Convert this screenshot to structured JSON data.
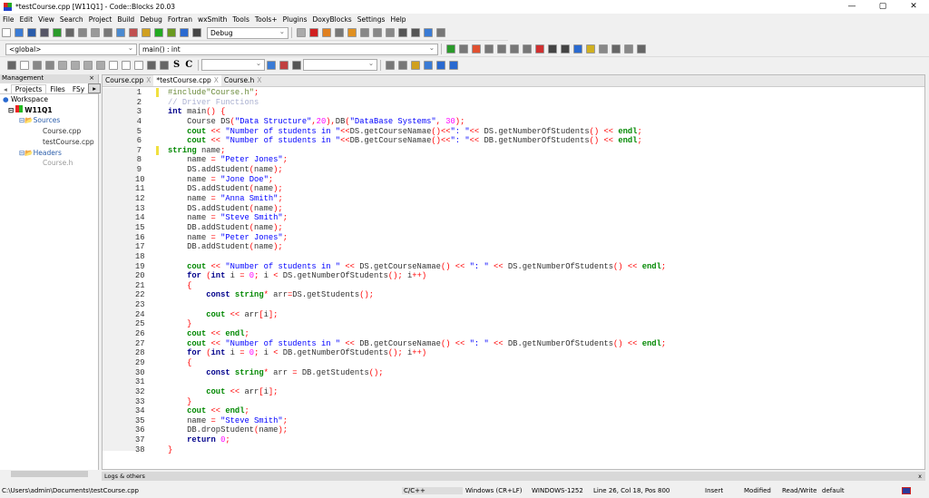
{
  "window": {
    "title": "*testCourse.cpp [W11Q1] - Code::Blocks 20.03",
    "minimize": "—",
    "maximize": "▢",
    "close": "✕"
  },
  "menu": [
    "File",
    "Edit",
    "View",
    "Search",
    "Project",
    "Build",
    "Debug",
    "Fortran",
    "wxSmith",
    "Tools",
    "Tools+",
    "Plugins",
    "DoxyBlocks",
    "Settings",
    "Help"
  ],
  "toolbar": {
    "build_target": "Debug",
    "scope": "<global>",
    "function": "main() : int",
    "search_a": "",
    "search_b": "",
    "bold_s": "S",
    "bold_c": "C"
  },
  "icons1": [
    [
      "new-file-icon",
      "#fff"
    ],
    [
      "open-icon",
      "#3a7bd5"
    ],
    [
      "save-icon",
      "#2a5caa"
    ],
    [
      "save-all-icon",
      "#556"
    ],
    [
      "undo-icon",
      "#2a9a2a"
    ],
    [
      "redo-icon",
      "#666"
    ],
    [
      "cut-icon",
      "#888"
    ],
    [
      "copy-icon",
      "#999"
    ],
    [
      "paste-icon",
      "#777"
    ],
    [
      "find-icon",
      "#4a8ad0"
    ],
    [
      "replace-icon",
      "#c05050"
    ],
    [
      "build-icon",
      "#d0a020"
    ],
    [
      "run-icon",
      "#22aa22"
    ],
    [
      "build-run-icon",
      "#6a9a20"
    ],
    [
      "rebuild-icon",
      "#2a6ad0"
    ],
    [
      "abort-icon",
      "#444"
    ]
  ],
  "icons1b": [
    [
      "debug-info-icon",
      "#aaa"
    ],
    [
      "debug-run-icon",
      "#d02020"
    ],
    [
      "run-to-cursor-icon",
      "#e08020"
    ],
    [
      "next-line-icon",
      "#777"
    ],
    [
      "step-into-icon",
      "#e09020"
    ],
    [
      "step-out-icon",
      "#888"
    ],
    [
      "next-instruction-icon",
      "#888"
    ],
    [
      "step-instruction-icon",
      "#888"
    ],
    [
      "pause-icon",
      "#555"
    ],
    [
      "stop-debug-icon",
      "#555"
    ],
    [
      "debug-windows-icon",
      "#3a7bd5"
    ],
    [
      "info-icon",
      "#777"
    ]
  ],
  "icons2": [
    [
      "back-icon",
      "#2a9a2a"
    ],
    [
      "forward-icon",
      "#777"
    ],
    [
      "bookmark-icon",
      "#e05030"
    ],
    [
      "prev-bookmark-icon",
      "#777"
    ],
    [
      "next-bookmark-icon",
      "#777"
    ],
    [
      "clear-bookmarks-icon",
      "#777"
    ],
    [
      "doxy-wizard-icon",
      "#777"
    ],
    [
      "doxy-extract-icon",
      "#d03030"
    ],
    [
      "comment-icon",
      "#444"
    ],
    [
      "line-comment-icon",
      "#444"
    ],
    [
      "html-icon",
      "#2a6ad0"
    ],
    [
      "chm-icon",
      "#d0b020"
    ],
    [
      "config-icon",
      "#888"
    ],
    [
      "jump-back-icon",
      "#666"
    ],
    [
      "jump-home-icon",
      "#888"
    ],
    [
      "jump-forward-icon",
      "#666"
    ]
  ],
  "icons3": [
    [
      "select-icon",
      "#666"
    ],
    [
      "rect-icon",
      "#fff"
    ],
    [
      "grid-icon",
      "#888"
    ],
    [
      "table-icon",
      "#888"
    ],
    [
      "layout1-icon",
      "#aaa"
    ],
    [
      "layout2-icon",
      "#aaa"
    ],
    [
      "layout3-icon",
      "#aaa"
    ],
    [
      "layout4-icon",
      "#aaa"
    ],
    [
      "frame1-icon",
      "#fff"
    ],
    [
      "frame2-icon",
      "#fff"
    ],
    [
      "frame3-icon",
      "#fff"
    ],
    [
      "zoom-in-icon",
      "#666"
    ],
    [
      "zoom-out-icon",
      "#666"
    ]
  ],
  "icons4": [
    [
      "search-go-icon",
      "#3a7bd5"
    ],
    [
      "settings-wrench-icon",
      "#c04040"
    ],
    [
      "clear-icon",
      "#555"
    ]
  ],
  "icons5": [
    [
      "find-prev-icon",
      "#777"
    ],
    [
      "find-next-icon",
      "#777"
    ],
    [
      "highlight-icon",
      "#d0a020"
    ],
    [
      "selected-text-icon",
      "#3a7bd5"
    ],
    [
      "match-case-icon",
      "#2a6ad0"
    ],
    [
      "regex-icon",
      "#2a6ad0"
    ]
  ],
  "management": {
    "title": "Management",
    "close": "×",
    "tabs": [
      "Projects",
      "Files",
      "FSy"
    ],
    "workspace": "Workspace",
    "project": "W11Q1",
    "sources": "Sources",
    "headers": "Headers",
    "files": [
      "Course.cpp",
      "testCourse.cpp",
      "Course.h"
    ]
  },
  "editor": {
    "tabs": [
      {
        "label": "Course.cpp",
        "close": "X"
      },
      {
        "label": "*testCourse.cpp",
        "close": "X"
      },
      {
        "label": "Course.h",
        "close": "X"
      }
    ]
  },
  "code": [
    [
      [
        "pp",
        "#include\"Course.h\""
      ],
      [
        "op",
        ";"
      ]
    ],
    [
      [
        "cm",
        "// Driver Functions"
      ]
    ],
    [
      [
        "kw",
        "int"
      ],
      [
        "id",
        " main"
      ],
      [
        "op",
        "() {"
      ]
    ],
    [
      [
        "id",
        "    Course DS"
      ],
      [
        "op",
        "("
      ],
      [
        "str",
        "\"Data Structure\""
      ],
      [
        "op",
        ","
      ],
      [
        "nm",
        "20"
      ],
      [
        "op",
        "),"
      ],
      [
        "id",
        "DB"
      ],
      [
        "op",
        "("
      ],
      [
        "str",
        "\"DataBase Systems\""
      ],
      [
        "op",
        ", "
      ],
      [
        "nm",
        "30"
      ],
      [
        "op",
        ");"
      ]
    ],
    [
      [
        "id",
        "    "
      ],
      [
        "kw2",
        "cout"
      ],
      [
        "op",
        " << "
      ],
      [
        "str",
        "\"Number of students in \""
      ],
      [
        "op",
        "<<"
      ],
      [
        "id",
        "DS.getCourseNamae"
      ],
      [
        "op",
        "()<<"
      ],
      [
        "str",
        "\": \""
      ],
      [
        "op",
        "<< "
      ],
      [
        "id",
        "DS.getNumberOfStudents"
      ],
      [
        "op",
        "() << "
      ],
      [
        "kw2",
        "endl"
      ],
      [
        "op",
        ";"
      ]
    ],
    [
      [
        "id",
        "    "
      ],
      [
        "kw2",
        "cout"
      ],
      [
        "op",
        " << "
      ],
      [
        "str",
        "\"Number of students in \""
      ],
      [
        "op",
        "<<"
      ],
      [
        "id",
        "DB.getCourseNamae"
      ],
      [
        "op",
        "()<<"
      ],
      [
        "str",
        "\": \""
      ],
      [
        "op",
        "<< "
      ],
      [
        "id",
        "DB.getNumberOfStudents"
      ],
      [
        "op",
        "() << "
      ],
      [
        "kw2",
        "endl"
      ],
      [
        "op",
        ";"
      ]
    ],
    [
      [
        "kw2",
        "string"
      ],
      [
        "id",
        " name"
      ],
      [
        "op",
        ";"
      ]
    ],
    [
      [
        "id",
        "    name "
      ],
      [
        "op",
        "= "
      ],
      [
        "str",
        "\"Peter Jones\""
      ],
      [
        "op",
        ";"
      ]
    ],
    [
      [
        "id",
        "    DS.addStudent"
      ],
      [
        "op",
        "("
      ],
      [
        "id",
        "name"
      ],
      [
        "op",
        ");"
      ]
    ],
    [
      [
        "id",
        "    name "
      ],
      [
        "op",
        "= "
      ],
      [
        "str",
        "\"Jone Doe\""
      ],
      [
        "op",
        ";"
      ]
    ],
    [
      [
        "id",
        "    DS.addStudent"
      ],
      [
        "op",
        "("
      ],
      [
        "id",
        "name"
      ],
      [
        "op",
        ");"
      ]
    ],
    [
      [
        "id",
        "    name "
      ],
      [
        "op",
        "= "
      ],
      [
        "str",
        "\"Anna Smith\""
      ],
      [
        "op",
        ";"
      ]
    ],
    [
      [
        "id",
        "    DS.addStudent"
      ],
      [
        "op",
        "("
      ],
      [
        "id",
        "name"
      ],
      [
        "op",
        ");"
      ]
    ],
    [
      [
        "id",
        "    name "
      ],
      [
        "op",
        "= "
      ],
      [
        "str",
        "\"Steve Smith\""
      ],
      [
        "op",
        ";"
      ]
    ],
    [
      [
        "id",
        "    DB.addStudent"
      ],
      [
        "op",
        "("
      ],
      [
        "id",
        "name"
      ],
      [
        "op",
        ");"
      ]
    ],
    [
      [
        "id",
        "    name "
      ],
      [
        "op",
        "= "
      ],
      [
        "str",
        "\"Peter Jones\""
      ],
      [
        "op",
        ";"
      ]
    ],
    [
      [
        "id",
        "    DB.addStudent"
      ],
      [
        "op",
        "("
      ],
      [
        "id",
        "name"
      ],
      [
        "op",
        ");"
      ]
    ],
    [],
    [
      [
        "id",
        "    "
      ],
      [
        "kw2",
        "cout"
      ],
      [
        "op",
        " << "
      ],
      [
        "str",
        "\"Number of students in \""
      ],
      [
        "op",
        " << "
      ],
      [
        "id",
        "DS.getCourseNamae"
      ],
      [
        "op",
        "() << "
      ],
      [
        "str",
        "\": \""
      ],
      [
        "op",
        " << "
      ],
      [
        "id",
        "DS.getNumberOfStudents"
      ],
      [
        "op",
        "() << "
      ],
      [
        "kw2",
        "endl"
      ],
      [
        "op",
        ";"
      ]
    ],
    [
      [
        "id",
        "    "
      ],
      [
        "kw",
        "for"
      ],
      [
        "op",
        " ("
      ],
      [
        "kw",
        "int"
      ],
      [
        "id",
        " i "
      ],
      [
        "op",
        "= "
      ],
      [
        "nm",
        "0"
      ],
      [
        "op",
        "; "
      ],
      [
        "id",
        "i "
      ],
      [
        "op",
        "< "
      ],
      [
        "id",
        "DS.getNumberOfStudents"
      ],
      [
        "op",
        "(); "
      ],
      [
        "id",
        "i"
      ],
      [
        "op",
        "++)"
      ]
    ],
    [
      [
        "op",
        "    {"
      ]
    ],
    [
      [
        "id",
        "        "
      ],
      [
        "kw",
        "const"
      ],
      [
        "kw2",
        " string"
      ],
      [
        "op",
        "* "
      ],
      [
        "id",
        "arr"
      ],
      [
        "op",
        "="
      ],
      [
        "id",
        "DS.getStudents"
      ],
      [
        "op",
        "();"
      ]
    ],
    [],
    [
      [
        "id",
        "        "
      ],
      [
        "kw2",
        "cout"
      ],
      [
        "op",
        " << "
      ],
      [
        "id",
        "arr"
      ],
      [
        "op",
        "["
      ],
      [
        "id",
        "i"
      ],
      [
        "op",
        "];"
      ]
    ],
    [
      [
        "op",
        "    }"
      ]
    ],
    [
      [
        "id",
        "    "
      ],
      [
        "kw2",
        "cout"
      ],
      [
        "op",
        " << "
      ],
      [
        "kw2",
        "endl"
      ],
      [
        "op",
        ";"
      ]
    ],
    [
      [
        "id",
        "    "
      ],
      [
        "kw2",
        "cout"
      ],
      [
        "op",
        " << "
      ],
      [
        "str",
        "\"Number of students in \""
      ],
      [
        "op",
        " << "
      ],
      [
        "id",
        "DB.getCourseNamae"
      ],
      [
        "op",
        "() << "
      ],
      [
        "str",
        "\": \""
      ],
      [
        "op",
        " << "
      ],
      [
        "id",
        "DB.getNumberOfStudents"
      ],
      [
        "op",
        "() << "
      ],
      [
        "kw2",
        "endl"
      ],
      [
        "op",
        ";"
      ]
    ],
    [
      [
        "id",
        "    "
      ],
      [
        "kw",
        "for"
      ],
      [
        "op",
        " ("
      ],
      [
        "kw",
        "int"
      ],
      [
        "id",
        " i "
      ],
      [
        "op",
        "= "
      ],
      [
        "nm",
        "0"
      ],
      [
        "op",
        "; "
      ],
      [
        "id",
        "i "
      ],
      [
        "op",
        "< "
      ],
      [
        "id",
        "DB.getNumberOfStudents"
      ],
      [
        "op",
        "(); "
      ],
      [
        "id",
        "i"
      ],
      [
        "op",
        "++)"
      ]
    ],
    [
      [
        "op",
        "    {"
      ]
    ],
    [
      [
        "id",
        "        "
      ],
      [
        "kw",
        "const"
      ],
      [
        "kw2",
        " string"
      ],
      [
        "op",
        "* "
      ],
      [
        "id",
        "arr "
      ],
      [
        "op",
        "= "
      ],
      [
        "id",
        "DB.getStudents"
      ],
      [
        "op",
        "();"
      ]
    ],
    [],
    [
      [
        "id",
        "        "
      ],
      [
        "kw2",
        "cout"
      ],
      [
        "op",
        " << "
      ],
      [
        "id",
        "arr"
      ],
      [
        "op",
        "["
      ],
      [
        "id",
        "i"
      ],
      [
        "op",
        "];"
      ]
    ],
    [
      [
        "op",
        "    }"
      ]
    ],
    [
      [
        "id",
        "    "
      ],
      [
        "kw2",
        "cout"
      ],
      [
        "op",
        " << "
      ],
      [
        "kw2",
        "endl"
      ],
      [
        "op",
        ";"
      ]
    ],
    [
      [
        "id",
        "    name "
      ],
      [
        "op",
        "= "
      ],
      [
        "str",
        "\"Steve Smith\""
      ],
      [
        "op",
        ";"
      ]
    ],
    [
      [
        "id",
        "    DB.dropStudent"
      ],
      [
        "op",
        "("
      ],
      [
        "id",
        "name"
      ],
      [
        "op",
        ");"
      ]
    ],
    [
      [
        "id",
        "    "
      ],
      [
        "kw",
        "return"
      ],
      [
        "nm",
        " 0"
      ],
      [
        "op",
        ";"
      ]
    ],
    [
      [
        "op",
        "}"
      ]
    ]
  ],
  "changed_lines": [
    1,
    7
  ],
  "logs": {
    "title": "Logs & others",
    "close": "x"
  },
  "status": {
    "path": "C:\\Users\\admin\\Documents\\testCourse.cpp",
    "language": "C/C++",
    "eol": "Windows (CR+LF)",
    "encoding": "WINDOWS-1252",
    "position": "Line 26, Col 18, Pos 800",
    "mode": "Insert",
    "modified": "Modified",
    "access": "Read/Write",
    "profile": "default"
  }
}
